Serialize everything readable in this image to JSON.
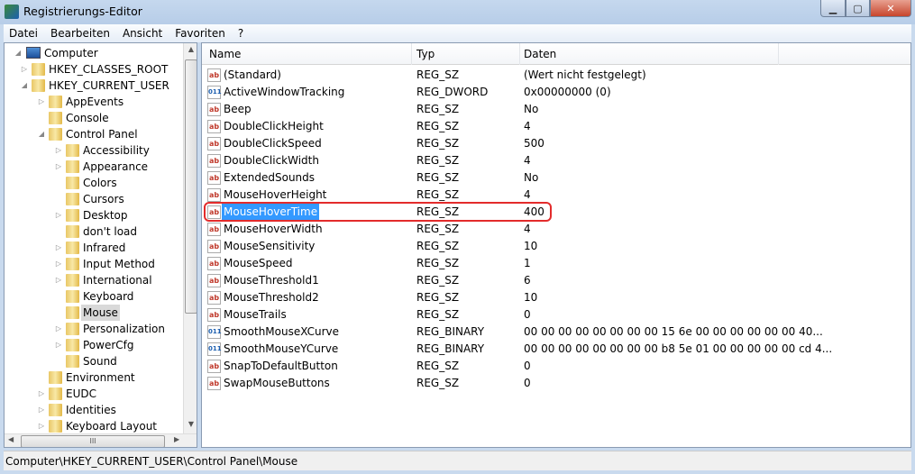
{
  "window": {
    "title": "Registrierungs-Editor",
    "icon": "regedit-icon"
  },
  "menu": [
    {
      "label": "Datei",
      "key": "D"
    },
    {
      "label": "Bearbeiten",
      "key": "B"
    },
    {
      "label": "Ansicht",
      "key": "A"
    },
    {
      "label": "Favoriten",
      "key": "F"
    },
    {
      "label": "?",
      "key": "?"
    }
  ],
  "tree": [
    {
      "label": "Computer",
      "level": 0,
      "expander": "expanded",
      "icon": "computer"
    },
    {
      "label": "HKEY_CLASSES_ROOT",
      "level": 1,
      "expander": "collapsed"
    },
    {
      "label": "HKEY_CURRENT_USER",
      "level": 1,
      "expander": "expanded"
    },
    {
      "label": "AppEvents",
      "level": 2,
      "expander": "collapsed"
    },
    {
      "label": "Console",
      "level": 2,
      "expander": "none"
    },
    {
      "label": "Control Panel",
      "level": 2,
      "expander": "expanded"
    },
    {
      "label": "Accessibility",
      "level": 3,
      "expander": "collapsed"
    },
    {
      "label": "Appearance",
      "level": 3,
      "expander": "collapsed"
    },
    {
      "label": "Colors",
      "level": 3,
      "expander": "none"
    },
    {
      "label": "Cursors",
      "level": 3,
      "expander": "none"
    },
    {
      "label": "Desktop",
      "level": 3,
      "expander": "collapsed"
    },
    {
      "label": "don't load",
      "level": 3,
      "expander": "none"
    },
    {
      "label": "Infrared",
      "level": 3,
      "expander": "collapsed"
    },
    {
      "label": "Input Method",
      "level": 3,
      "expander": "collapsed"
    },
    {
      "label": "International",
      "level": 3,
      "expander": "collapsed"
    },
    {
      "label": "Keyboard",
      "level": 3,
      "expander": "none"
    },
    {
      "label": "Mouse",
      "level": 3,
      "expander": "none",
      "selected": true
    },
    {
      "label": "Personalization",
      "level": 3,
      "expander": "collapsed"
    },
    {
      "label": "PowerCfg",
      "level": 3,
      "expander": "collapsed"
    },
    {
      "label": "Sound",
      "level": 3,
      "expander": "none"
    },
    {
      "label": "Environment",
      "level": 2,
      "expander": "none"
    },
    {
      "label": "EUDC",
      "level": 2,
      "expander": "collapsed"
    },
    {
      "label": "Identities",
      "level": 2,
      "expander": "collapsed"
    },
    {
      "label": "Keyboard Layout",
      "level": 2,
      "expander": "collapsed"
    }
  ],
  "columns": {
    "name": "Name",
    "type": "Typ",
    "data": "Daten"
  },
  "values": [
    {
      "name": "(Standard)",
      "type": "REG_SZ",
      "data": "(Wert nicht festgelegt)"
    },
    {
      "name": "ActiveWindowTracking",
      "type": "REG_DWORD",
      "data": "0x00000000 (0)"
    },
    {
      "name": "Beep",
      "type": "REG_SZ",
      "data": "No"
    },
    {
      "name": "DoubleClickHeight",
      "type": "REG_SZ",
      "data": "4"
    },
    {
      "name": "DoubleClickSpeed",
      "type": "REG_SZ",
      "data": "500"
    },
    {
      "name": "DoubleClickWidth",
      "type": "REG_SZ",
      "data": "4"
    },
    {
      "name": "ExtendedSounds",
      "type": "REG_SZ",
      "data": "No"
    },
    {
      "name": "MouseHoverHeight",
      "type": "REG_SZ",
      "data": "4"
    },
    {
      "name": "MouseHoverTime",
      "type": "REG_SZ",
      "data": "400",
      "selected": true,
      "highlighted": true
    },
    {
      "name": "MouseHoverWidth",
      "type": "REG_SZ",
      "data": "4"
    },
    {
      "name": "MouseSensitivity",
      "type": "REG_SZ",
      "data": "10"
    },
    {
      "name": "MouseSpeed",
      "type": "REG_SZ",
      "data": "1"
    },
    {
      "name": "MouseThreshold1",
      "type": "REG_SZ",
      "data": "6"
    },
    {
      "name": "MouseThreshold2",
      "type": "REG_SZ",
      "data": "10"
    },
    {
      "name": "MouseTrails",
      "type": "REG_SZ",
      "data": "0"
    },
    {
      "name": "SmoothMouseXCurve",
      "type": "REG_BINARY",
      "data": "00 00 00 00 00 00 00 00 15 6e 00 00 00 00 00 00 40..."
    },
    {
      "name": "SmoothMouseYCurve",
      "type": "REG_BINARY",
      "data": "00 00 00 00 00 00 00 00 b8 5e 01 00 00 00 00 00 cd 4..."
    },
    {
      "name": "SnapToDefaultButton",
      "type": "REG_SZ",
      "data": "0"
    },
    {
      "name": "SwapMouseButtons",
      "type": "REG_SZ",
      "data": "0"
    }
  ],
  "status": "Computer\\HKEY_CURRENT_USER\\Control Panel\\Mouse",
  "colors": {
    "selection": "#3399ff",
    "highlight_box": "#e32b2b",
    "close_button": "#c7452c"
  }
}
